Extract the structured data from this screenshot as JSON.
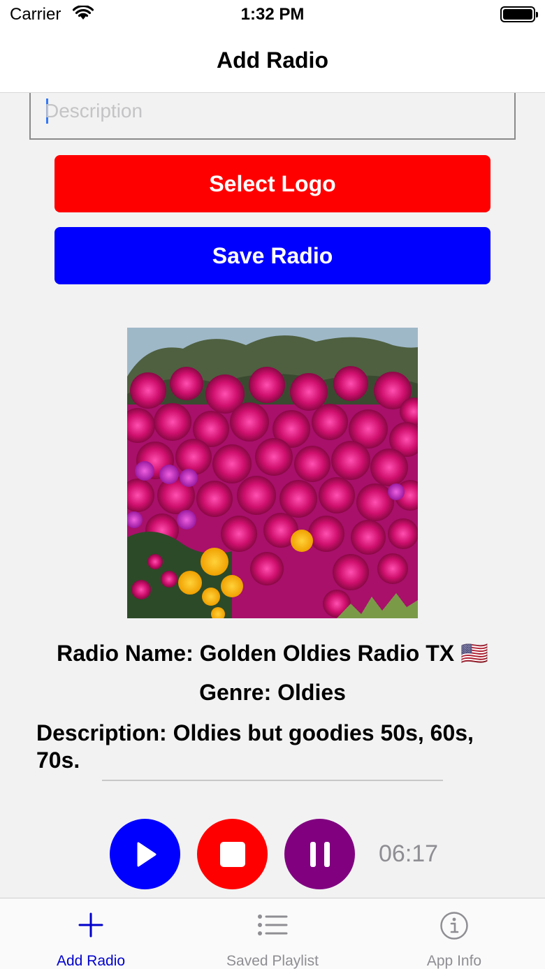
{
  "status_bar": {
    "carrier": "Carrier",
    "time": "1:32 PM"
  },
  "nav": {
    "title": "Add Radio"
  },
  "form": {
    "description_placeholder": "Description",
    "description_value": "",
    "select_logo_label": "Select Logo",
    "save_radio_label": "Save Radio"
  },
  "radio": {
    "name_line": "Radio Name: Golden Oldies Radio TX 🇺🇸",
    "genre_line": "Genre: Oldies",
    "description_line": "Description: Oldies but goodies 50s, 60s, 70s."
  },
  "player": {
    "elapsed": "06:17"
  },
  "tabs": [
    {
      "label": "Add Radio",
      "icon": "plus-icon",
      "active": true
    },
    {
      "label": "Saved Playlist",
      "icon": "list-icon",
      "active": false
    },
    {
      "label": "App Info",
      "icon": "info-icon",
      "active": false
    }
  ],
  "colors": {
    "select_logo": "#ff0000",
    "save_radio": "#0000ff",
    "play": "#0000ff",
    "stop": "#ff0000",
    "pause": "#800080",
    "tab_active": "#0000cc",
    "tab_inactive": "#8e8e93"
  }
}
